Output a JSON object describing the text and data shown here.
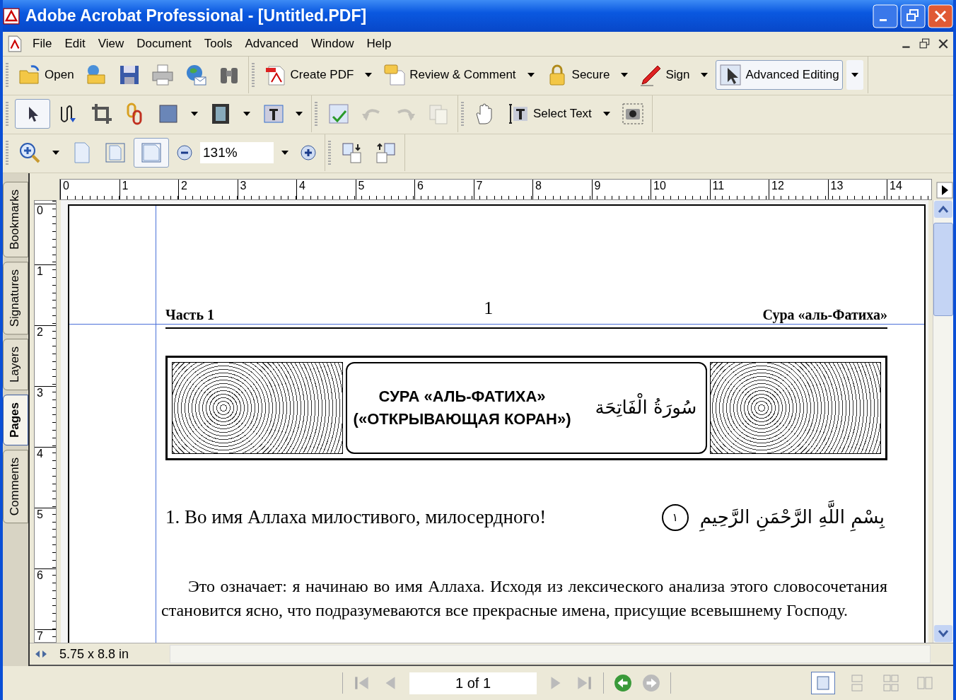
{
  "window": {
    "title": "Adobe Acrobat Professional - [Untitled.PDF]"
  },
  "menu": [
    {
      "label": "File"
    },
    {
      "label": "Edit"
    },
    {
      "label": "View"
    },
    {
      "label": "Document"
    },
    {
      "label": "Tools"
    },
    {
      "label": "Advanced"
    },
    {
      "label": "Window"
    },
    {
      "label": "Help"
    }
  ],
  "toolbar_file": {
    "open": "Open"
  },
  "toolbar_tasks": {
    "create_pdf": "Create PDF",
    "review": "Review & Comment",
    "secure": "Secure",
    "sign": "Sign",
    "advanced_editing": {
      "label": "Advanced Editing",
      "selected": true
    }
  },
  "toolbar_edit": {
    "arrow_selected": true,
    "undo_disabled": true,
    "redo_disabled": true,
    "paste_disabled": true,
    "select_text": "Select Text"
  },
  "toolbar_zoom": {
    "fit_page_selected": true,
    "zoom": "131%"
  },
  "ruler_h": [
    "0",
    "1",
    "2",
    "3",
    "4",
    "5",
    "6",
    "7",
    "8",
    "9",
    "10",
    "11",
    "12",
    "13",
    "14"
  ],
  "ruler_v": [
    "0",
    "1",
    "2",
    "3",
    "4",
    "5",
    "6",
    "7"
  ],
  "nav_tabs": [
    {
      "label": "Bookmarks",
      "selected": false
    },
    {
      "label": "Signatures",
      "selected": false
    },
    {
      "label": "Layers",
      "selected": false
    },
    {
      "label": "Pages",
      "selected": true
    },
    {
      "label": "Comments",
      "selected": false
    }
  ],
  "document": {
    "header_left": "Часть 1",
    "header_center": "1",
    "header_right": "Сура «аль-Фатиха»",
    "banner_title": [
      "СУРА «АЛЬ-ФАТИХА»",
      "(«ОТКРЫВАЮЩАЯ КОРАН»)"
    ],
    "banner_arabic": "سُورَةُ الْفَاتِحَة",
    "verse": "1. Во имя Аллаха милостивого, милосердного!",
    "verse_number": "١",
    "verse_arabic": "بِسْمِ اللَّهِ الرَّحْمَنِ الرَّحِيمِ",
    "paragraph": "Это означает: я начинаю во имя Аллаха. Исходя из лексического анализа этого словосочетания становится ясно, что подразумеваются все прекрасные имена, присущие всевышнему Господу."
  },
  "page_size": "5.75 x 8.8 in",
  "status": {
    "page": "1 of 1",
    "views": [
      {
        "selected": true
      },
      {
        "selected": false
      },
      {
        "selected": false
      },
      {
        "selected": false
      }
    ]
  }
}
